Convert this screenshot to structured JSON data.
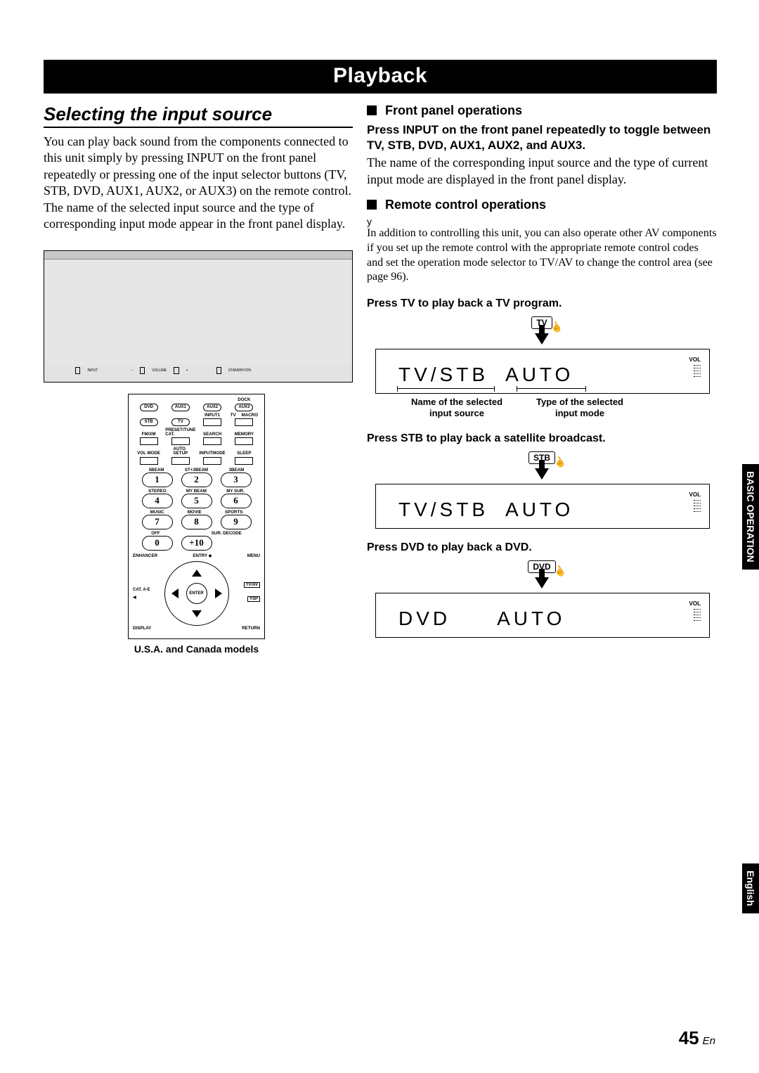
{
  "page": {
    "title": "Playback",
    "section_heading": "Selecting the input source",
    "intro": "You can play back sound from the components connected to this unit simply by pressing INPUT on the front panel repeatedly or pressing one of the input selector buttons (TV, STB, DVD, AUX1, AUX2, or AUX3) on the remote control. The name of the selected input source and the type of corresponding input mode appear in the front panel display.",
    "remote_caption": "U.S.A. and Canada models",
    "page_number": "45",
    "page_lang_suffix": "En"
  },
  "front_panel": {
    "labels": {
      "input": "INPUT",
      "volume": "VOLUME",
      "standby": "STANDBY/ON",
      "minus": "–",
      "plus": "+"
    }
  },
  "remote": {
    "row1": {
      "dvd": "DVD",
      "aux1": "AUX1",
      "aux2": "AUX2",
      "aux3": "AUX3",
      "dock": "DOCK"
    },
    "row2": {
      "stb": "STB",
      "tv": "TV",
      "input1": "INPUT1",
      "tvlbl": "TV",
      "macro": "MACRO"
    },
    "row3": {
      "fmxm": "FM/XM",
      "preset": "PRESET/TUNE",
      "cat": "CAT.",
      "search": "SEARCH",
      "memory": "MEMORY"
    },
    "row4": {
      "volmode": "VOL MODE",
      "auto": "AUTO",
      "setup": "SETUP",
      "inputmode": "INPUTMODE",
      "sleep": "SLEEP"
    },
    "mode_row1": {
      "a": "5BEAM",
      "b": "ST+3BEAM",
      "c": "3BEAM"
    },
    "mode_row2": {
      "a": "STEREO",
      "b": "MY BEAM",
      "c": "MY SUR."
    },
    "mode_row3": {
      "a": "MUSIC",
      "b": "MOVIE",
      "c": "SPORTS"
    },
    "mode_row4": {
      "a": "OFF",
      "b": "",
      "c": "SUR. DECODE"
    },
    "nums": {
      "n1": "1",
      "n2": "2",
      "n3": "3",
      "n4": "4",
      "n5": "5",
      "n6": "6",
      "n7": "7",
      "n8": "8",
      "n9": "9",
      "n0": "0",
      "n10": "+10"
    },
    "bottom": {
      "enhancer": "ENHANCER",
      "entry": "ENTRY",
      "menu": "MENU",
      "tvav": "TV/AV",
      "ysp": "YSP",
      "display": "DISPLAY",
      "ret": "RETURN",
      "enter": "ENTER",
      "cat": "CAT.\nA-E"
    }
  },
  "right": {
    "h_front": "Front panel operations",
    "front_bold": "Press INPUT on the front panel repeatedly to toggle between TV, STB, DVD, AUX1, AUX2, and AUX3.",
    "front_para": "The name of the corresponding input source and the type of current input mode are displayed in the front panel display.",
    "h_remote": "Remote control operations",
    "y": "y",
    "note": "In addition to controlling this unit, you can also operate other AV components if you set up the remote control with the appropriate remote control codes and set the operation mode selector to TV/AV to change the control area (see page 96).",
    "press_tv": "Press TV to play back a TV program.",
    "press_stb": "Press STB to play back a satellite broadcast.",
    "press_dvd": "Press DVD to play back a DVD.",
    "btn_tv": "TV",
    "btn_stb": "STB",
    "btn_dvd": "DVD",
    "lcd1a": "TV/STB",
    "lcd1b": "AUTO",
    "cap1a": "Name of the selected input source",
    "cap1b": "Type of the selected input mode",
    "lcd2a": "TV/STB",
    "lcd2b": "AUTO",
    "lcd3a": "DVD",
    "lcd3b": "AUTO",
    "vol": "VOL"
  },
  "tabs": {
    "operation": "BASIC OPERATION",
    "english": "English"
  }
}
